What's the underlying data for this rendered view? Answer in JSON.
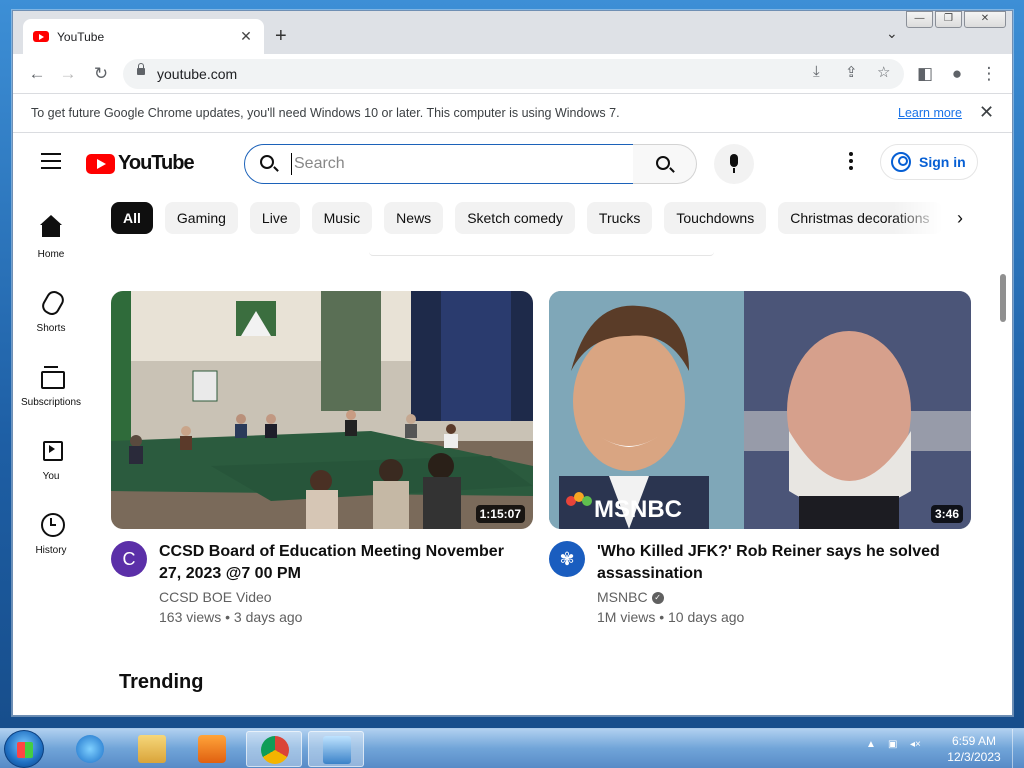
{
  "browser": {
    "tab_title": "YouTube",
    "new_tab_symbol": "+",
    "url": "youtube.com",
    "window_controls": {
      "minimize": "—",
      "restore": "❐",
      "close": "✕"
    }
  },
  "infobar": {
    "message": "To get future Google Chrome updates, you'll need Windows 10 or later. This computer is using Windows 7.",
    "link": "Learn more"
  },
  "youtube": {
    "logo_text": "YouTube",
    "search_placeholder": "Search",
    "sign_in": "Sign in",
    "chips": [
      "All",
      "Gaming",
      "Live",
      "Music",
      "News",
      "Sketch comedy",
      "Trucks",
      "Touchdowns",
      "Christmas decorations"
    ],
    "guide": [
      {
        "label": "Home",
        "icon": "home-icon"
      },
      {
        "label": "Shorts",
        "icon": "shorts-icon"
      },
      {
        "label": "Subscriptions",
        "icon": "subscriptions-icon"
      },
      {
        "label": "You",
        "icon": "you-icon"
      },
      {
        "label": "History",
        "icon": "history-icon"
      }
    ],
    "videos": [
      {
        "title": "CCSD Board of Education Meeting November 27, 2023 @7 00 PM",
        "channel": "CCSD BOE Video",
        "stats": "163 views • 3 days ago",
        "duration": "1:15:07",
        "avatar_letter": "C",
        "avatar_color": "#5b2fa8"
      },
      {
        "title": "'Who Killed JFK?' Rob Reiner says he solved assassination",
        "channel": "MSNBC",
        "stats": "1M views • 10 days ago",
        "duration": "3:46",
        "thumb_logo": "MSNBC",
        "avatar_color": "#1a5dbf"
      }
    ],
    "section_title": "Trending"
  },
  "taskbar": {
    "clock_time": "6:59 AM",
    "clock_date": "12/3/2023"
  }
}
